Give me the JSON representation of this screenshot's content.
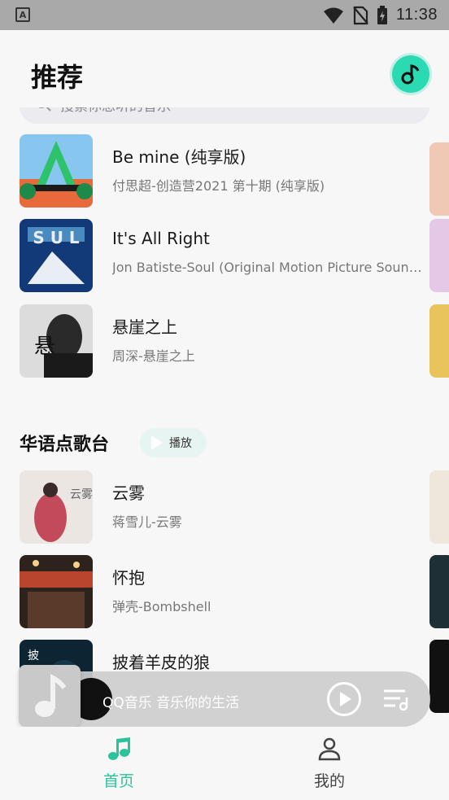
{
  "status_bar": {
    "time": "11:38",
    "indicator": "A"
  },
  "header": {
    "title": "推荐"
  },
  "search": {
    "placeholder": "搜索你想听的音乐"
  },
  "recommended_songs": [
    {
      "name": "Be mine (纯享版)",
      "artist": "付思超-创造营2021 第十期 (纯享版)",
      "cover_color": "#3aa0d8"
    },
    {
      "name": "It's All Right",
      "artist": "Jon Batiste-Soul (Original Motion Picture Soundtrack)",
      "cover_color": "#1f4d8c"
    },
    {
      "name": "悬崖之上",
      "artist": "周深-悬崖之上",
      "cover_color": "#d8d8d8"
    }
  ],
  "chinese_section": {
    "title": "华语点歌台",
    "play_label": "播放",
    "songs": [
      {
        "name": "云雾",
        "artist": "蒋雪儿-云雾",
        "cover_color": "#e8e2dd"
      },
      {
        "name": "怀抱",
        "artist": "弹壳-Bombshell",
        "cover_color": "#3a2a22"
      },
      {
        "name": "披着羊皮的狼",
        "artist": "",
        "cover_color": "#0e2a3a"
      }
    ]
  },
  "player": {
    "text": "QQ音乐 音乐你的生活"
  },
  "bottom_nav": {
    "home": "首页",
    "mine": "我的"
  },
  "colors": {
    "accent": "#2bc39a",
    "music_button": "#2bd9b2"
  }
}
